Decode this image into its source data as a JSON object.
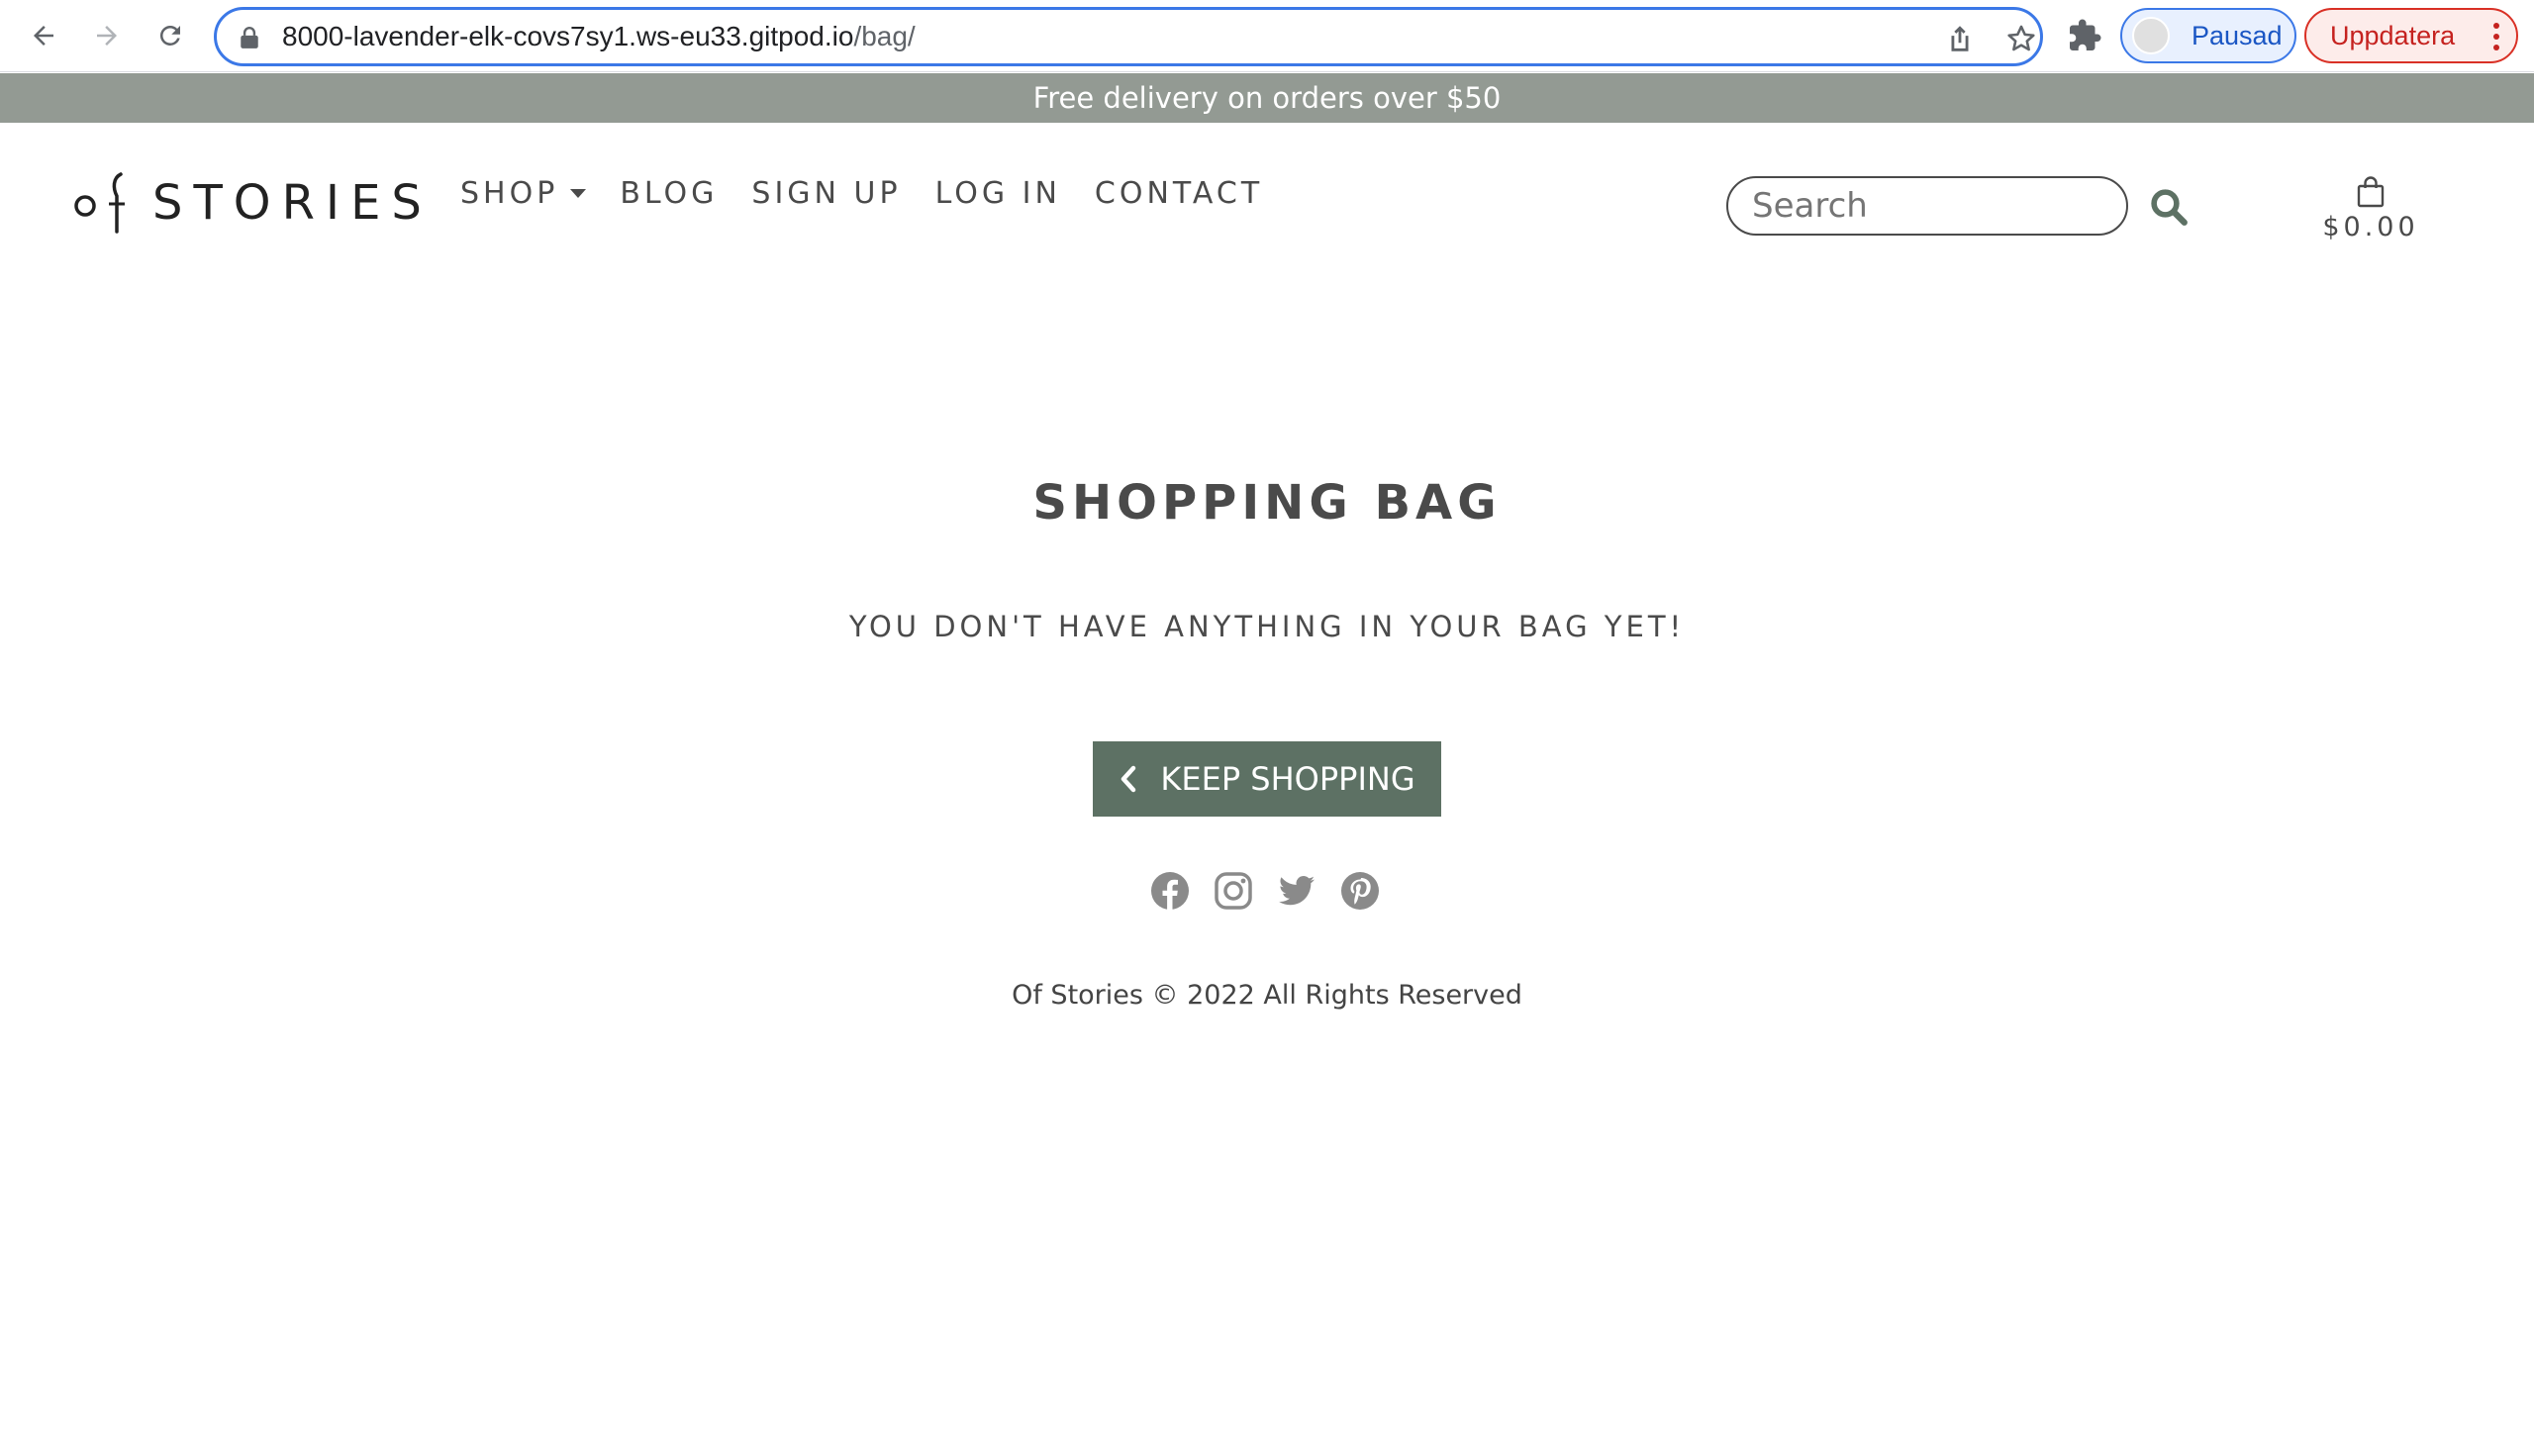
{
  "browser": {
    "url_host": "8000-lavender-elk-covs7sy1.ws-eu33.gitpod.io",
    "url_path": "/bag/",
    "profile_label": "Pausad",
    "update_label": "Uppdatera"
  },
  "announcement": "Free delivery on orders over $50",
  "header": {
    "logo_text": "STORIES",
    "nav": {
      "shop": "SHOP",
      "blog": "BLOG",
      "signup": "SIGN UP",
      "login": "LOG IN",
      "contact": "CONTACT"
    },
    "search_placeholder": "Search",
    "bag_total": "$0.00"
  },
  "main": {
    "title": "SHOPPING BAG",
    "empty_message": "YOU DON'T HAVE ANYTHING IN YOUR BAG YET!",
    "keep_shopping": "KEEP SHOPPING"
  },
  "footer": {
    "social": [
      "facebook-icon",
      "instagram-icon",
      "twitter-icon",
      "pinterest-icon"
    ],
    "copyright": "Of Stories © 2022 All Rights Reserved"
  },
  "colors": {
    "announcement_bg": "#939a93",
    "brand_green": "#5d7164",
    "social_icon": "#8a8a8a"
  }
}
